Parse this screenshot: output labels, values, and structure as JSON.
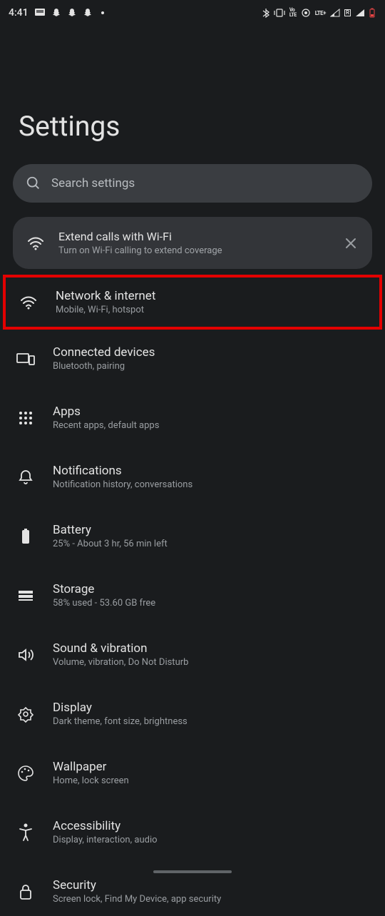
{
  "status_bar": {
    "time": "4:41",
    "lte_label": "LTE+",
    "volte_label": "Vo LTE"
  },
  "page_title": "Settings",
  "search": {
    "placeholder": "Search settings"
  },
  "promo": {
    "title": "Extend calls with Wi-Fi",
    "subtitle": "Turn on Wi-Fi calling to extend coverage"
  },
  "items": [
    {
      "title": "Network & internet",
      "subtitle": "Mobile, Wi-Fi, hotspot"
    },
    {
      "title": "Connected devices",
      "subtitle": "Bluetooth, pairing"
    },
    {
      "title": "Apps",
      "subtitle": "Recent apps, default apps"
    },
    {
      "title": "Notifications",
      "subtitle": "Notification history, conversations"
    },
    {
      "title": "Battery",
      "subtitle": "25% - About 3 hr, 56 min left"
    },
    {
      "title": "Storage",
      "subtitle": "58% used - 53.60 GB free"
    },
    {
      "title": "Sound & vibration",
      "subtitle": "Volume, vibration, Do Not Disturb"
    },
    {
      "title": "Display",
      "subtitle": "Dark theme, font size, brightness"
    },
    {
      "title": "Wallpaper",
      "subtitle": "Home, lock screen"
    },
    {
      "title": "Accessibility",
      "subtitle": "Display, interaction, audio"
    },
    {
      "title": "Security",
      "subtitle": "Screen lock, Find My Device, app security"
    }
  ]
}
